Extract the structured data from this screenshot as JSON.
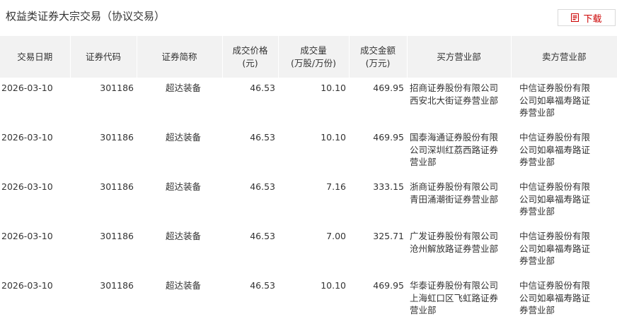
{
  "header": {
    "title": "权益类证券大宗交易（协议交易）",
    "download_label": "下载"
  },
  "table": {
    "columns": [
      [
        "交易日期"
      ],
      [
        "证券代码"
      ],
      [
        "证券简称"
      ],
      [
        "成交价格",
        "(元)"
      ],
      [
        "成交量",
        "(万股/万份)"
      ],
      [
        "成交金额",
        "(万元)"
      ],
      [
        "买方营业部"
      ],
      [
        "卖方营业部"
      ]
    ],
    "rows": [
      {
        "date": "2026-03-10",
        "code": "301186",
        "name": "超达装备",
        "price": "46.53",
        "volume": "10.10",
        "amount": "469.95",
        "buyer": "招商证券股份有限公司西安北大街证券营业部",
        "seller": "中信证券股份有限公司如皋福寿路证券营业部"
      },
      {
        "date": "2026-03-10",
        "code": "301186",
        "name": "超达装备",
        "price": "46.53",
        "volume": "10.10",
        "amount": "469.95",
        "buyer": "国泰海通证券股份有限公司深圳红荔西路证券营业部",
        "seller": "中信证券股份有限公司如皋福寿路证券营业部"
      },
      {
        "date": "2026-03-10",
        "code": "301186",
        "name": "超达装备",
        "price": "46.53",
        "volume": "7.16",
        "amount": "333.15",
        "buyer": "浙商证券股份有限公司青田涌潮街证券营业部",
        "seller": "中信证券股份有限公司如皋福寿路证券营业部"
      },
      {
        "date": "2026-03-10",
        "code": "301186",
        "name": "超达装备",
        "price": "46.53",
        "volume": "7.00",
        "amount": "325.71",
        "buyer": "广发证券股份有限公司沧州解放路证券营业部",
        "seller": "中信证券股份有限公司如皋福寿路证券营业部"
      },
      {
        "date": "2026-03-10",
        "code": "301186",
        "name": "超达装备",
        "price": "46.53",
        "volume": "10.10",
        "amount": "469.95",
        "buyer": "华泰证券股份有限公司上海虹口区飞虹路证券营业部",
        "seller": "中信证券股份有限公司如皋福寿路证券营业部"
      }
    ]
  },
  "colors": {
    "header_bg": "#f2f2f2",
    "accent": "#cc0000",
    "text": "#333333",
    "border": "#d9d9d9"
  },
  "icons": {
    "download": "download-icon"
  }
}
